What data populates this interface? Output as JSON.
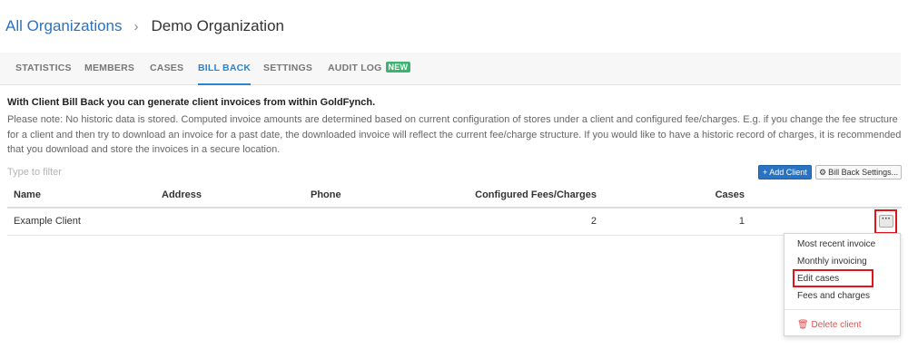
{
  "breadcrumb": {
    "root": "All Organizations",
    "separator": "›",
    "current": "Demo Organization"
  },
  "tabs": [
    {
      "label": "STATISTICS",
      "active": false
    },
    {
      "label": "MEMBERS",
      "active": false
    },
    {
      "label": "CASES",
      "active": false
    },
    {
      "label": "BILL BACK",
      "active": true
    },
    {
      "label": "SETTINGS",
      "active": false
    },
    {
      "label": "AUDIT LOG",
      "active": false,
      "badge": "NEW"
    }
  ],
  "intro": "With Client Bill Back you can generate client invoices from within GoldFynch.",
  "note": "Please note: No historic data is stored. Computed invoice amounts are determined based on current configuration of stores under a client and configured fee/charges. E.g. if you change the fee structure for a client and then try to download an invoice for a past date, the downloaded invoice will reflect the current fee/charge structure. If you would like to have a historic record of charges, it is recommended that you download and store the invoices in a secure location.",
  "filter": {
    "placeholder": "Type to filter",
    "value": ""
  },
  "buttons": {
    "add_client": "+ Add Client",
    "settings_icon": "⚙",
    "settings": "Bill Back Settings..."
  },
  "table": {
    "headers": [
      "Name",
      "Address",
      "Phone",
      "Configured Fees/Charges",
      "Cases"
    ],
    "rows": [
      {
        "name": "Example Client",
        "address": "",
        "phone": "",
        "fees": "2",
        "cases": "1",
        "menu": "···"
      }
    ]
  },
  "row_menu": {
    "items": [
      "Most recent invoice",
      "Monthly invoicing",
      "Edit cases",
      "Fees and charges"
    ],
    "delete_icon": "🗑",
    "delete": "Delete client"
  },
  "colors": {
    "accent": "#2a73c2",
    "active_tab": "#2a85d0",
    "badge_new": "#3cb371",
    "danger": "#d9534f",
    "highlight": "#e0151c"
  },
  "icons": {
    "breadcrumb_separator": "chevron-right-icon",
    "settings": "gear-icon",
    "row_menu": "ellipsis-icon",
    "delete": "trash-icon"
  }
}
